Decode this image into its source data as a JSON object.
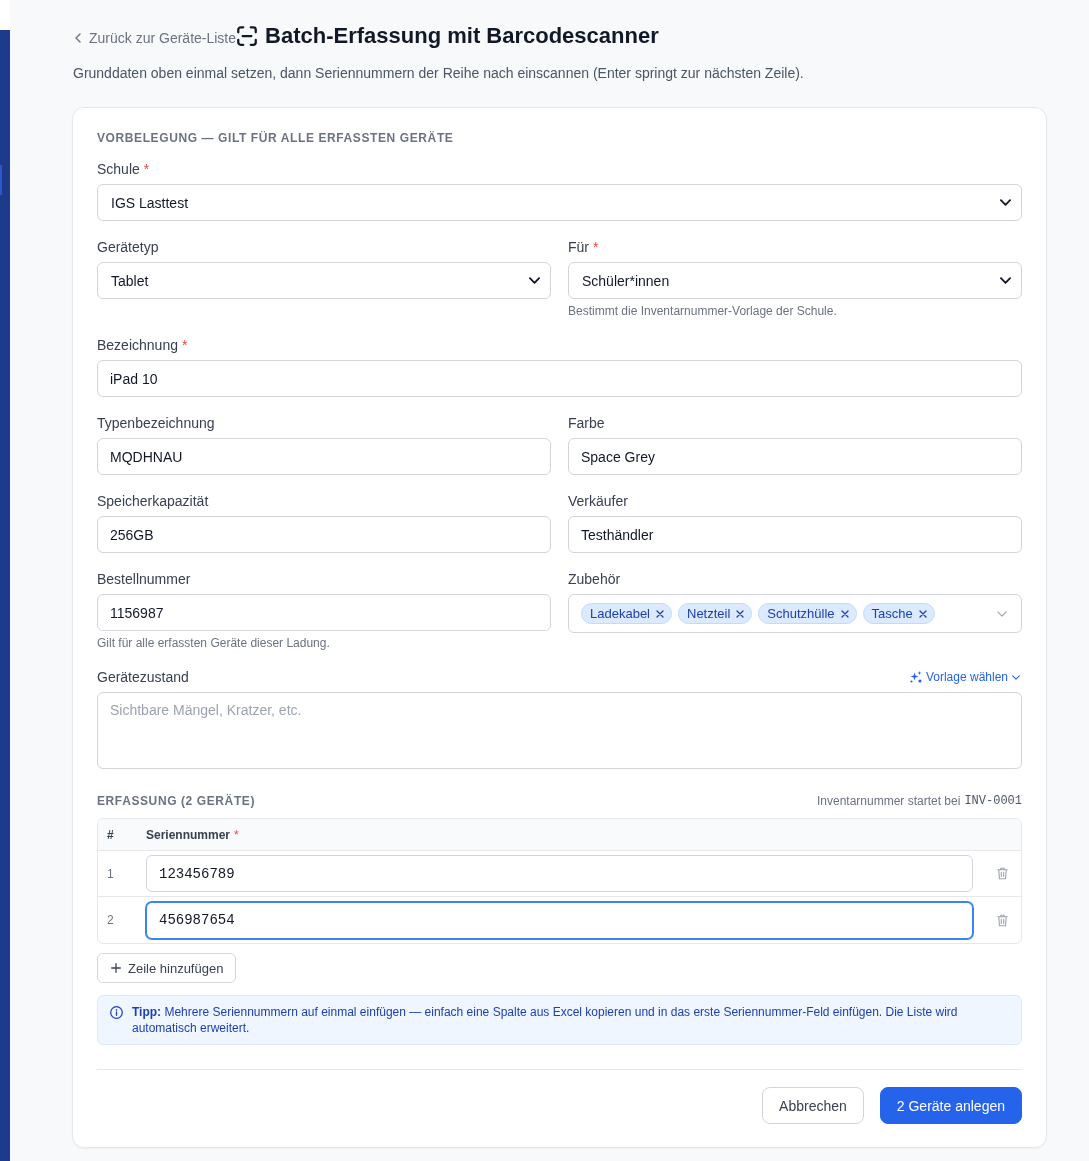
{
  "sidebar": {
    "items": [
      {
        "selected": true
      }
    ]
  },
  "header": {
    "back_link": "Zurück zur Geräte-Liste",
    "title": "Batch-Erfassung mit Barcodescanner",
    "subtitle": "Grunddaten oben einmal setzen, dann Seriennummern der Reihe nach einscannen (Enter springt zur nächsten Zeile)."
  },
  "preset": {
    "heading": "VORBELEGUNG — GILT FÜR ALLE ERFASSTEN GERÄTE",
    "rows": [
      {
        "fields": [
          {
            "kind": "select",
            "label": "Schule",
            "required_mark": "*",
            "value": "IGS Lasttest"
          }
        ]
      },
      {
        "fields": [
          {
            "kind": "select",
            "label": "Gerätetyp",
            "value": "Tablet"
          },
          {
            "kind": "select",
            "label": "Für",
            "required_mark": "*",
            "value": "Schüler*innen",
            "hint": "Bestimmt die Inventarnummer-Vorlage der Schule."
          }
        ]
      },
      {
        "fields": [
          {
            "kind": "input",
            "label": "Bezeichnung",
            "required_mark": "*",
            "value": "iPad 10"
          }
        ]
      },
      {
        "fields": [
          {
            "kind": "input",
            "label": "Typenbezeichnung",
            "value": "MQDHNAU"
          },
          {
            "kind": "input",
            "label": "Farbe",
            "value": "Space Grey"
          }
        ]
      },
      {
        "fields": [
          {
            "kind": "input",
            "label": "Speicherkapazität",
            "value": "256GB"
          },
          {
            "kind": "input",
            "label": "Verkäufer",
            "value": "Testhändler"
          }
        ]
      },
      {
        "fields": [
          {
            "kind": "input",
            "label": "Bestellnummer",
            "value": "1156987",
            "hint": "Gilt für alle erfassten Geräte dieser Ladung."
          },
          {
            "kind": "tags",
            "label": "Zubehör",
            "tags": [
              "Ladekabel",
              "Netzteil",
              "Schutzhülle",
              "Tasche"
            ]
          }
        ]
      },
      {
        "fields": [
          {
            "kind": "textarea",
            "label": "Gerätezustand",
            "placeholder": "Sichtbare Mängel, Kratzer, etc.",
            "action": "Vorlage wählen"
          }
        ]
      }
    ]
  },
  "capture": {
    "heading": "ERFASSUNG (2 GERÄTE)",
    "inventory_note": "Inventarnummer startet bei",
    "inventory_start": "INV-0001",
    "columns": [
      {
        "label": "#"
      },
      {
        "label": "Seriennummer",
        "required_mark": "*"
      }
    ],
    "rows": [
      {
        "number": "1",
        "serial": "123456789",
        "focused": false
      },
      {
        "number": "2",
        "serial": "456987654",
        "focused": true
      }
    ],
    "add_row_button": "Zeile hinzufügen"
  },
  "tip": {
    "text": "**Tipp:** Mehrere Seriennummern auf einmal einfügen — einfach eine Spalte aus Excel kopieren und in das erste Seriennummer-Feld einfügen. Die Liste wird automatisch erweitert."
  },
  "actions": [
    {
      "kind": "secondary",
      "label": "Abbrechen"
    },
    {
      "kind": "primary",
      "label": "2 Geräte anlegen"
    }
  ]
}
